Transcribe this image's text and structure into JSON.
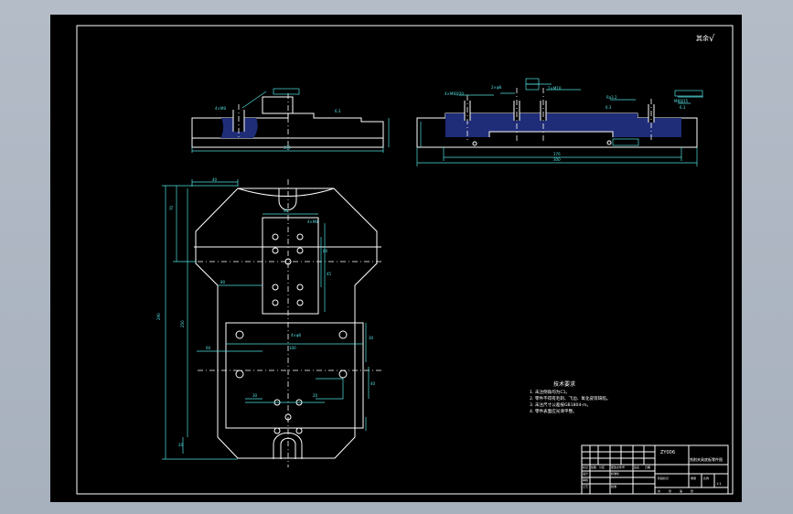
{
  "rough_mark": "其余",
  "rough_symbol": "√",
  "tech_title": "技术要求",
  "tech_notes": [
    "1. 未注倒角均为C1。",
    "2. 零件不得有毛刺、飞边、氧化皮等缺陷。",
    "3. 未注尺寸公差按GB1804-m。",
    "4. 零件表面应光滑平整。"
  ],
  "drawing_code": "ZY006",
  "drawing_name": "铣削夹具底板零件图",
  "title_block_cells": [
    "标记",
    "处数",
    "分区",
    "更改文件号",
    "签名",
    "日期",
    "设计",
    "标准化",
    "阶段标记",
    "重量",
    "比例",
    "审核",
    "工艺",
    "批准",
    "共",
    "张",
    "第",
    "张",
    "1:1"
  ],
  "colors": {
    "background": "#000000",
    "frame": "#ffffff",
    "dimension": "#52e0e0",
    "hatch": "#1f2d78"
  }
}
